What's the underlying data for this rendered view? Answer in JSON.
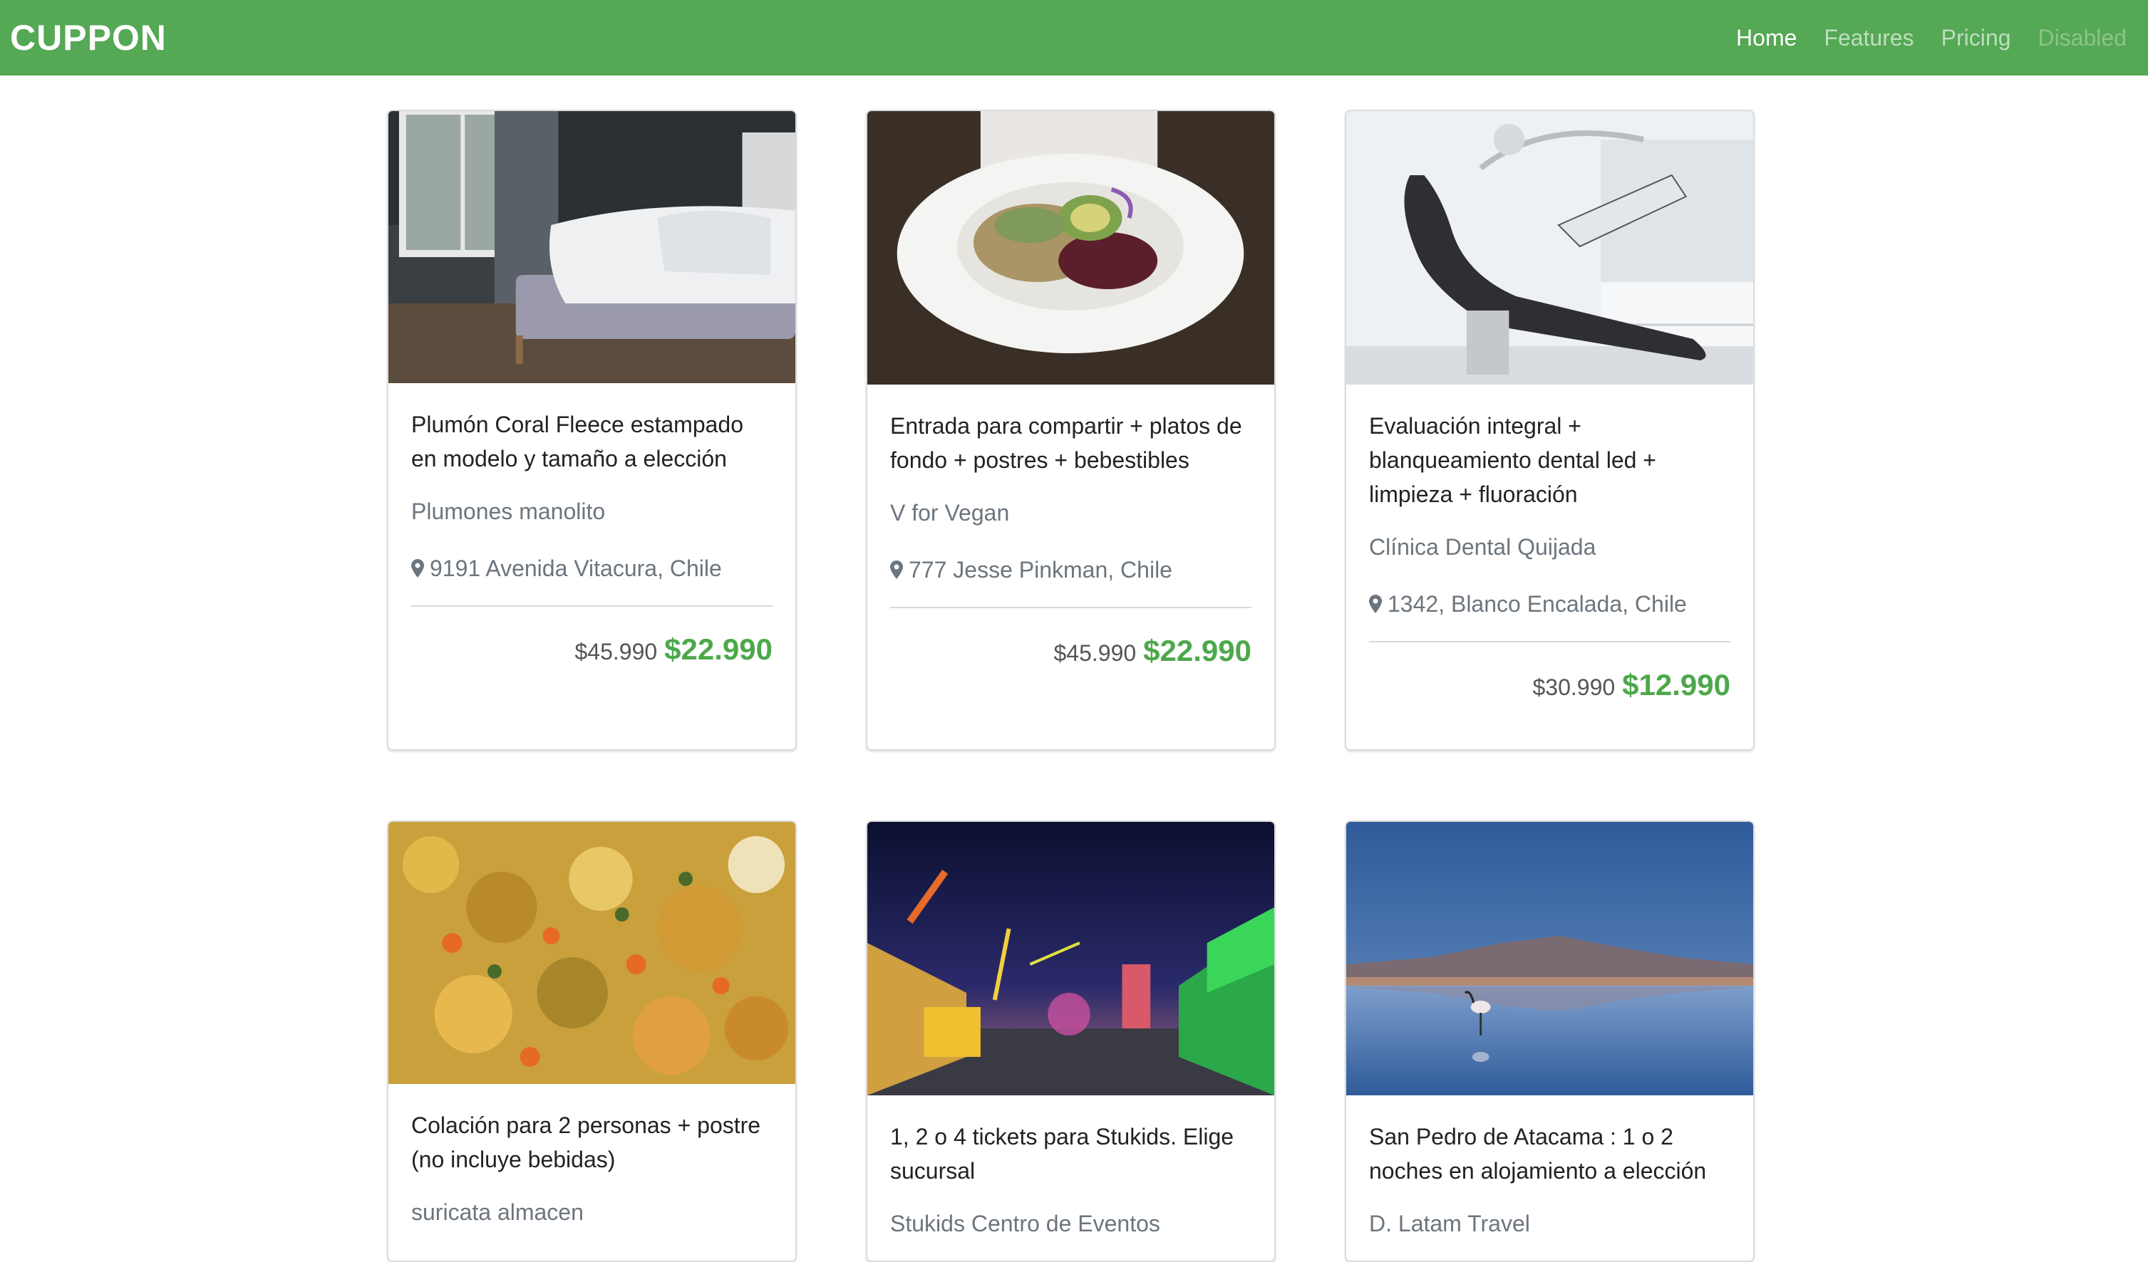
{
  "navbar": {
    "brand": "CUPPON",
    "links": [
      {
        "label": "Home",
        "state": "active"
      },
      {
        "label": "Features",
        "state": "normal"
      },
      {
        "label": "Pricing",
        "state": "normal"
      },
      {
        "label": "Disabled",
        "state": "disabled"
      }
    ]
  },
  "colors": {
    "navbar_bg": "#55a854",
    "price_green": "#4da84c",
    "muted_text": "#6c757d"
  },
  "cards": [
    {
      "image": "bedroom-bed-photo",
      "title": "Plumón Coral Fleece estampado en modelo y tamaño a elección",
      "merchant": "Plumones manolito",
      "address": "9191 Avenida Vitacura, Chile",
      "old_price": "$45.990",
      "new_price": "$22.990"
    },
    {
      "image": "vegan-salad-bowl-photo",
      "title": "Entrada para compartir + platos de fondo + postres + bebestibles",
      "merchant": "V for Vegan",
      "address": "777 Jesse Pinkman, Chile",
      "old_price": "$45.990",
      "new_price": "$22.990"
    },
    {
      "image": "dental-chair-photo",
      "title": "Evaluación integral + blanqueamiento dental led + limpieza + fluoración",
      "merchant": "Clínica Dental Quijada",
      "address": "1342, Blanco Encalada, Chile",
      "old_price": "$30.990",
      "new_price": "$12.990"
    },
    {
      "image": "vegetable-rice-dish-photo",
      "title": "Colación para 2 personas + postre (no incluye bebidas)",
      "merchant": "suricata almacen"
    },
    {
      "image": "amusement-park-night-photo",
      "title": "1, 2 o 4 tickets para Stukids. Elige sucursal",
      "merchant": "Stukids Centro de Eventos"
    },
    {
      "image": "flamingo-lagoon-photo",
      "title": "San Pedro de Atacama : 1 o 2 noches en alojamiento a elección",
      "merchant": "D. Latam Travel"
    }
  ]
}
